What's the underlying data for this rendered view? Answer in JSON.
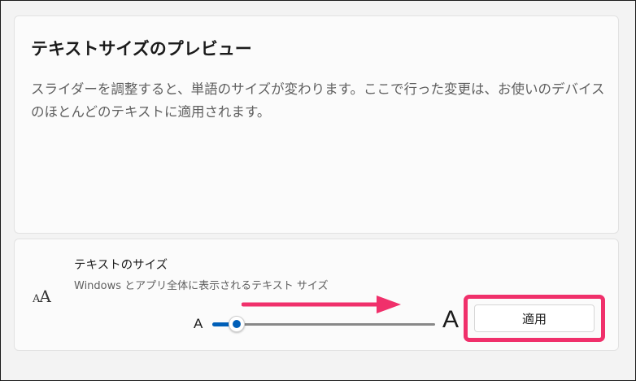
{
  "preview": {
    "title": "テキストサイズのプレビュー",
    "description": "スライダーを調整すると、単語のサイズが変わります。ここで行った変更は、お使いのデバイスのほとんどのテキストに適用されます。"
  },
  "text_size": {
    "icon": "text-size-icon",
    "title": "テキストのサイズ",
    "description": "Windows とアプリ全体に表示されるテキスト サイズ",
    "slider_min_label": "A",
    "slider_max_label": "A",
    "slider_value_fraction": 0.11,
    "apply_label": "適用"
  },
  "colors": {
    "accent": "#005fb8",
    "annotation": "#f0306b"
  }
}
